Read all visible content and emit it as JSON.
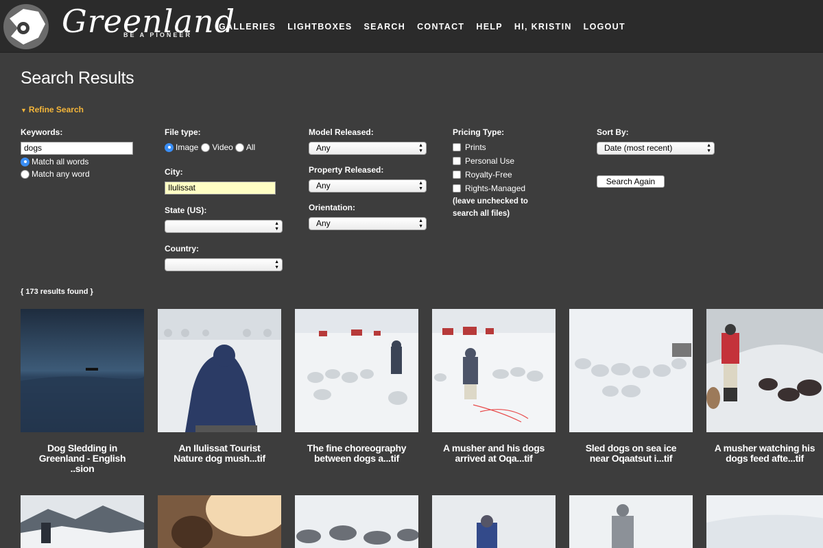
{
  "brand": {
    "name": "Greenland",
    "tagline": "BE A PIONEER"
  },
  "nav": [
    "GALLERIES",
    "LIGHTBOXES",
    "SEARCH",
    "CONTACT",
    "HELP",
    "HI, KRISTIN",
    "LOGOUT"
  ],
  "page": {
    "title": "Search Results",
    "refine": "Refine Search"
  },
  "form": {
    "keywords": {
      "label": "Keywords:",
      "value": "dogs",
      "match_all": "Match all words",
      "match_any": "Match any word"
    },
    "file_type": {
      "label": "File type:",
      "image": "Image",
      "video": "Video",
      "all": "All"
    },
    "city": {
      "label": "City:",
      "value": "Ilulissat"
    },
    "state": {
      "label": "State (US):",
      "value": ""
    },
    "country": {
      "label": "Country:",
      "value": ""
    },
    "model_released": {
      "label": "Model Released:",
      "value": "Any"
    },
    "property_released": {
      "label": "Property Released:",
      "value": "Any"
    },
    "orientation": {
      "label": "Orientation:",
      "value": "Any"
    },
    "pricing": {
      "label": "Pricing Type:",
      "options": [
        "Prints",
        "Personal Use",
        "Royalty-Free",
        "Rights-Managed"
      ],
      "note1": "(leave unchecked to",
      "note2": "search all files)"
    },
    "sort": {
      "label": "Sort By:",
      "value": "Date (most recent)"
    },
    "search_again": "Search Again"
  },
  "results": {
    "count_text": "{ 173 results found }",
    "items": [
      {
        "l1": "Dog Sledding in",
        "l2": "Greenland - English",
        "l3": "..sion"
      },
      {
        "l1": "An Ilulissat Tourist",
        "l2": "Nature dog mush...tif",
        "l3": ""
      },
      {
        "l1": "The fine choreography",
        "l2": "between dogs a...tif",
        "l3": ""
      },
      {
        "l1": "A musher and his dogs",
        "l2": "arrived at Oqa...tif",
        "l3": ""
      },
      {
        "l1": "Sled dogs on sea ice",
        "l2": "near Oqaatsut i...tif",
        "l3": ""
      },
      {
        "l1": "A musher watching his",
        "l2": "dogs feed afte...tif",
        "l3": ""
      }
    ]
  }
}
